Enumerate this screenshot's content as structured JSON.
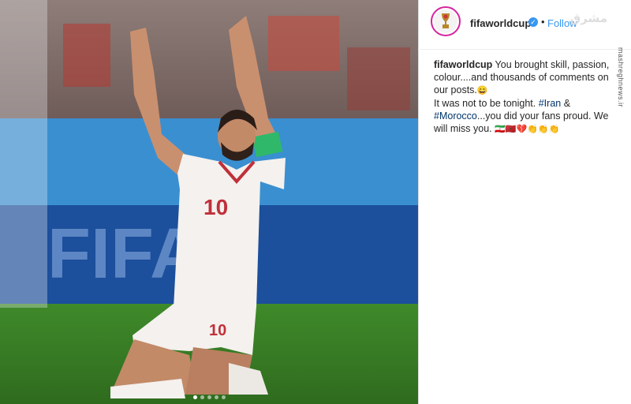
{
  "post": {
    "photo_banner_text": "FIFA",
    "jersey_number": "10",
    "shorts_number": "10",
    "carousel": {
      "count": 5,
      "active_index": 0
    }
  },
  "header": {
    "username": "fifaworldcup",
    "verified_icon": "verified-check-icon",
    "separator": "•",
    "follow_label": "Follow"
  },
  "caption": {
    "username": "fifaworldcup",
    "line1": " You brought skill, passion, colour....and thousands of comments on our posts.",
    "line1_emoji": "😄",
    "line2_prefix": "It was not to be tonight. ",
    "hashtag_iran": "#Iran",
    "line2_amp": " &",
    "hashtag_morocco": "#Morocco",
    "line3": "...you did your fans proud. We will miss you. ",
    "end_emoji": "🇮🇷🇲🇦💔👏👏👏"
  },
  "watermark": {
    "logo_text": "مشرق",
    "site": "mashreghnews.ir"
  },
  "colors": {
    "follow": "#3897f0",
    "hashtag": "#003569",
    "pitch": "#3b7a27"
  }
}
